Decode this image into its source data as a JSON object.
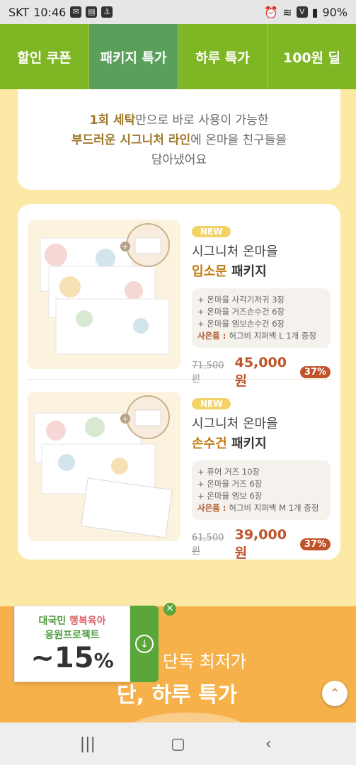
{
  "status_bar": {
    "carrier": "SKT",
    "time": "10:46",
    "battery": "90%",
    "left_icons": [
      "message-icon",
      "clipboard-icon",
      "vpn-icon"
    ],
    "right_icons": [
      "alarm-icon",
      "wifi-icon",
      "volte-icon",
      "signal-icon"
    ]
  },
  "tabs": [
    {
      "label": "할인 쿠폰",
      "active": false
    },
    {
      "label": "패키지 특가",
      "active": true
    },
    {
      "label": "하루 특가",
      "active": false
    },
    {
      "label": "100원 딜",
      "active": false
    }
  ],
  "intro": {
    "line1_highlight": "1회 세탁",
    "line1_rest": "만으로 바로 사용이 가능한",
    "line2_highlight": "부드러운 시그니처 라인",
    "line2_rest": "에 온마을 친구들을",
    "line3": "담아냈어요"
  },
  "products": [
    {
      "badge": "NEW",
      "name_line1": "시그니처 온마을",
      "name_accent": "입소문",
      "name_rest": " 패키지",
      "features": [
        "+ 온마을 사각기저귀 3장",
        "+ 온마을 거즈손수건 6장",
        "+ 온마을 엠보손수건 6장"
      ],
      "gift_label": "사은품 : ",
      "gift_text": "허그비 지퍼백 L 1개 증정",
      "original_price": "71,500원",
      "sale_price": "45,000원",
      "discount": "37%"
    },
    {
      "badge": "NEW",
      "name_line1": "시그니처 온마을",
      "name_accent": "손수건",
      "name_rest": " 패키지",
      "features": [
        "+ 퓨어 거즈 10장",
        "+ 온마을 거즈 6장",
        "+ 온마을 엠보 6장"
      ],
      "gift_label": "사은품 : ",
      "gift_text": "허그비 지퍼백 M 1개 증정",
      "original_price": "61,500원",
      "sale_price": "39,000원",
      "discount": "37%"
    }
  ],
  "promo": {
    "line1": "단독 최저가",
    "line2": "단, 하루 특가"
  },
  "banner": {
    "line1_a": "대국민 ",
    "line1_b": "행복육아",
    "line2": "응원프로젝트",
    "discount_num": "~15",
    "discount_pct": "%"
  },
  "colors": {
    "tab_green": "#7fb623",
    "active_tab": "#5aa05a",
    "page_bg": "#fde9a6",
    "price_red": "#c0532a",
    "promo_orange": "#f6b14a"
  }
}
